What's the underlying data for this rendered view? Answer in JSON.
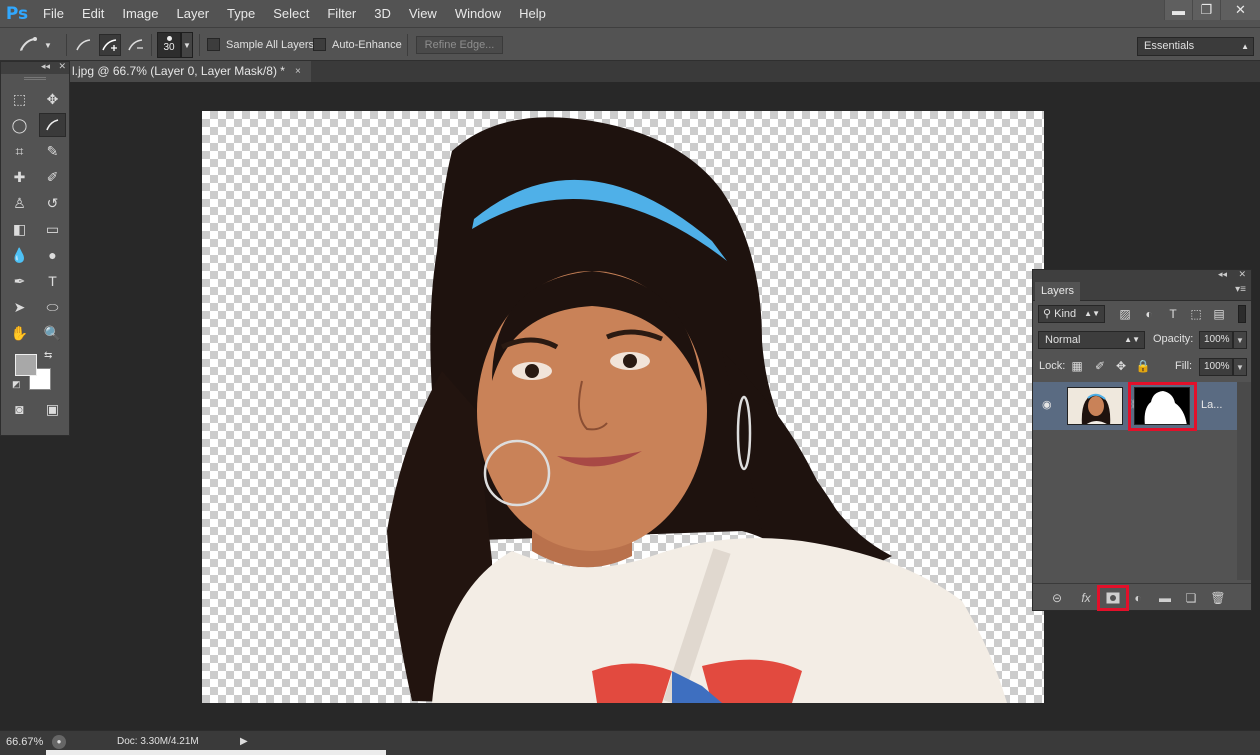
{
  "app": {
    "logo": "Ps"
  },
  "menu": [
    "File",
    "Edit",
    "Image",
    "Layer",
    "Type",
    "Select",
    "Filter",
    "3D",
    "View",
    "Window",
    "Help"
  ],
  "window_controls": {
    "minimize": "▬",
    "restore": "❐",
    "close": "✕"
  },
  "options": {
    "brush_size": "30",
    "sample_all_layers": "Sample All Layers",
    "auto_enhance": "Auto-Enhance",
    "refine_edge": "Refine Edge...",
    "workspace": "Essentials"
  },
  "document": {
    "tab_title": "l.jpg @ 66.7% (Layer 0, Layer Mask/8) *",
    "close": "×"
  },
  "layers_panel": {
    "tab": "Layers",
    "kind": "Kind",
    "blend_mode": "Normal",
    "opacity_label": "Opacity:",
    "opacity_value": "100%",
    "lock_label": "Lock:",
    "fill_label": "Fill:",
    "fill_value": "100%",
    "layer_name": "La..."
  },
  "status": {
    "zoom": "66.67%",
    "doc": "Doc: 3.30M/4.21M"
  },
  "colors": {
    "foreground": "#a8a8a8",
    "background": "#ffffff",
    "highlight": "#e3102a",
    "headband": "#4fb0e8"
  }
}
